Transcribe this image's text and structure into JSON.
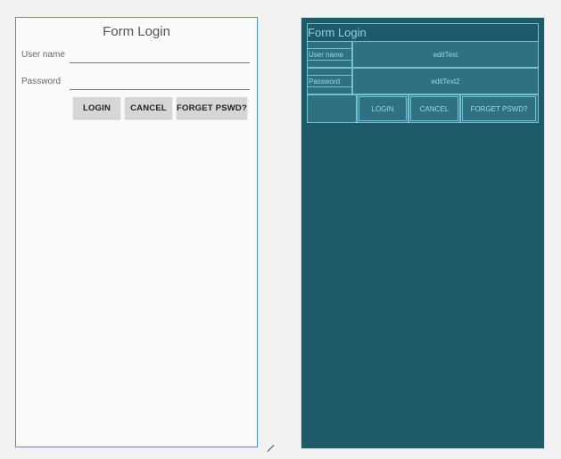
{
  "form": {
    "title": "Form Login",
    "username_label": "User name",
    "password_label": "Password",
    "username_value": "",
    "password_value": "",
    "login_button": "LOGIN",
    "cancel_button": "CANCEL",
    "forget_button": "FORGET PSWD?"
  },
  "blueprint": {
    "title": "Form Login",
    "username_label": "User name",
    "password_label": "Password",
    "edit_text_1": "editText",
    "edit_text_2": "editText2",
    "login_button": "LOGIN",
    "cancel_button": "CANCEL",
    "forget_button": "FORGET PSWD?"
  },
  "colors": {
    "design_border": "#4a90d9",
    "blueprint_bg": "#1f5a6b",
    "blueprint_outline": "#6fc3d3",
    "button_bg": "#d6d6d6"
  }
}
